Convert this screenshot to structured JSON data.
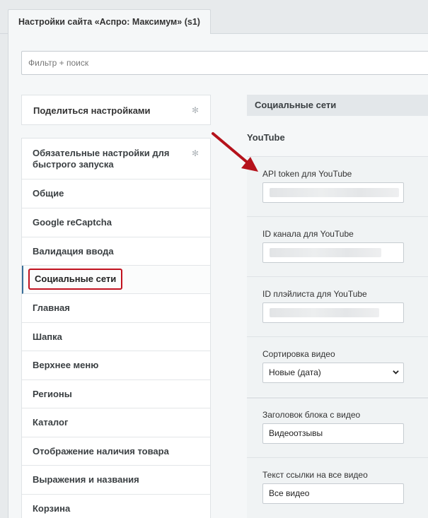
{
  "tab": {
    "title": "Настройки сайта «Аспро: Максимум» (s1)"
  },
  "search": {
    "placeholder": "Фильтр + поиск"
  },
  "share": {
    "label": "Поделиться настройками"
  },
  "nav": {
    "items": [
      "Обязательные настройки для быстрого запуска",
      "Общие",
      "Google reCaptcha",
      "Валидация ввода",
      "Социальные сети",
      "Главная",
      "Шапка",
      "Верхнее меню",
      "Регионы",
      "Каталог",
      "Отображение наличия товара",
      "Выражения и названия",
      "Корзина"
    ],
    "active_index": 4
  },
  "section": {
    "title": "Социальные сети",
    "group": "YouTube"
  },
  "fields": {
    "api_token_label": "API token для YouTube",
    "channel_id_label": "ID канала для YouTube",
    "playlist_id_label": "ID плэйлиста для YouTube",
    "sort_label": "Сортировка видео",
    "sort_value": "Новые (дата)",
    "block_title_label": "Заголовок блока с видео",
    "block_title_value": "Видеоотзывы",
    "link_text_label": "Текст ссылки на все видео",
    "link_text_value": "Все видео"
  },
  "colors": {
    "highlight": "#c1121f",
    "annotation_arrow": "#b5121b"
  }
}
